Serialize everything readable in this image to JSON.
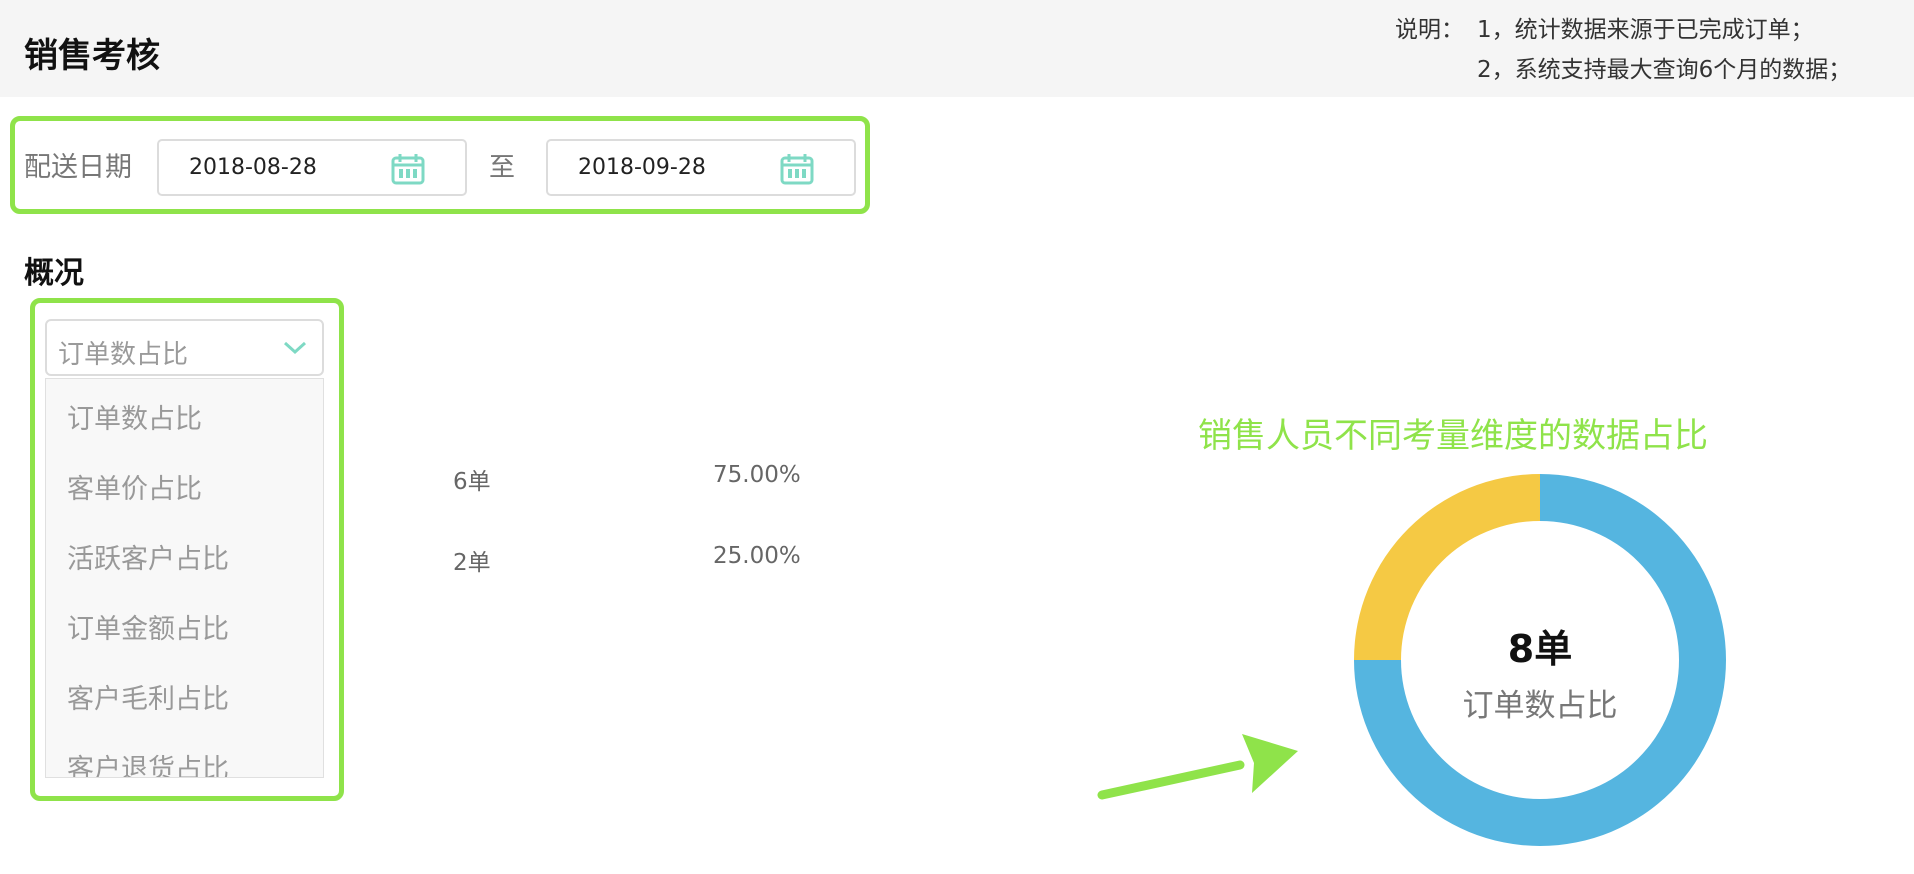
{
  "header": {
    "title": "销售考核",
    "notes_label": "说明：",
    "notes": [
      "1，统计数据来源于已完成订单；",
      "2，系统支持最大查询6个月的数据；"
    ]
  },
  "date_filter": {
    "label": "配送日期",
    "start": "2018-08-28",
    "separator": "至",
    "end": "2018-09-28"
  },
  "overview": {
    "title": "概况",
    "selected": "订单数占比",
    "options": [
      "订单数占比",
      "客单价占比",
      "活跃客户占比",
      "订单金额占比",
      "客户毛利占比",
      "客户退货占比"
    ],
    "rows": [
      {
        "count": "6单",
        "percent": "75.00%"
      },
      {
        "count": "2单",
        "percent": "25.00%"
      }
    ]
  },
  "chart_caption": "销售人员不同考量维度的数据占比",
  "colors": {
    "highlight": "#8fe34a",
    "accent": "#7ed9c4",
    "series_1": "#55b5e0",
    "series_2": "#f5c944"
  },
  "chart_data": {
    "type": "pie",
    "donut": true,
    "center_value": "8单",
    "center_label": "订单数占比",
    "series": [
      {
        "value": 6,
        "percent": 75.0,
        "color": "#55b5e0"
      },
      {
        "value": 2,
        "percent": 25.0,
        "color": "#f5c944"
      }
    ]
  }
}
